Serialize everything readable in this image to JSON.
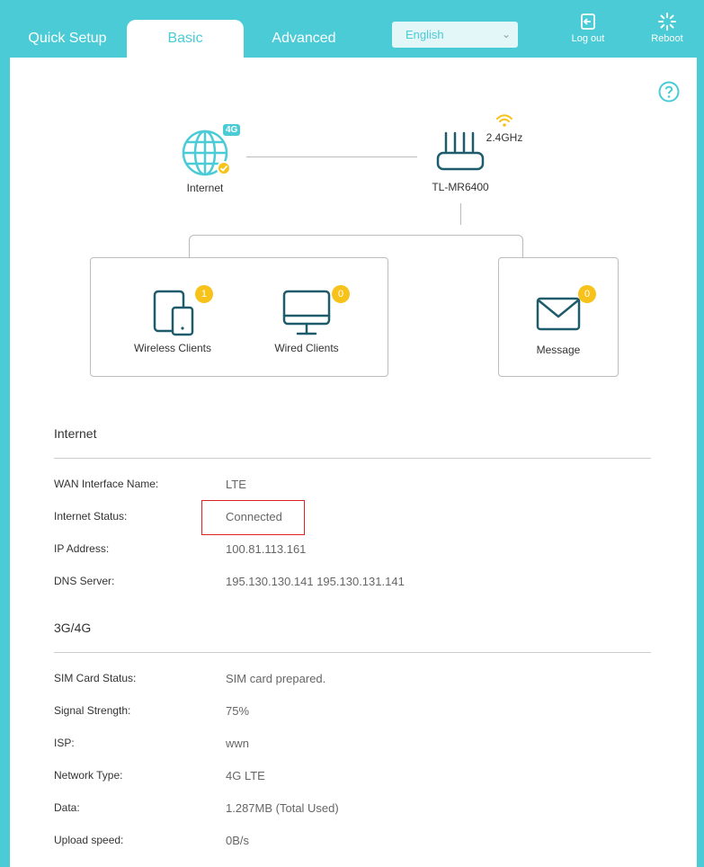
{
  "tabs": [
    {
      "label": "Quick Setup"
    },
    {
      "label": "Basic"
    },
    {
      "label": "Advanced"
    }
  ],
  "language": {
    "selected": "English"
  },
  "header_buttons": {
    "logout": "Log out",
    "reboot": "Reboot"
  },
  "colors": {
    "accent": "#4acbd6",
    "badge": "#f7c21a",
    "icon": "#1f5c6b",
    "highlight": "#dd2222"
  },
  "diagram": {
    "internet_label": "Internet",
    "internet_tag": "4G",
    "router_name": "TL-MR6400",
    "band": "2.4GHz",
    "wireless_clients": {
      "label": "Wireless Clients",
      "count": "1"
    },
    "wired_clients": {
      "label": "Wired Clients",
      "count": "0"
    },
    "message": {
      "label": "Message",
      "count": "0"
    }
  },
  "internet_section": {
    "title": "Internet",
    "rows": [
      {
        "key": "WAN Interface Name:",
        "value": "LTE"
      },
      {
        "key": "Internet Status:",
        "value": "Connected"
      },
      {
        "key": "IP Address:",
        "value": "100.81.113.161"
      },
      {
        "key": "DNS Server:",
        "value": "195.130.130.141 195.130.131.141"
      }
    ]
  },
  "lte_section": {
    "title": "3G/4G",
    "rows": [
      {
        "key": "SIM Card Status:",
        "value": "SIM card prepared."
      },
      {
        "key": "Signal Strength:",
        "value": "75%"
      },
      {
        "key": "ISP:",
        "value": "wwn"
      },
      {
        "key": "Network Type:",
        "value": "4G LTE"
      },
      {
        "key": "Data:",
        "value": "1.287MB (Total Used)"
      },
      {
        "key": "Upload speed:",
        "value": "0B/s"
      }
    ]
  }
}
